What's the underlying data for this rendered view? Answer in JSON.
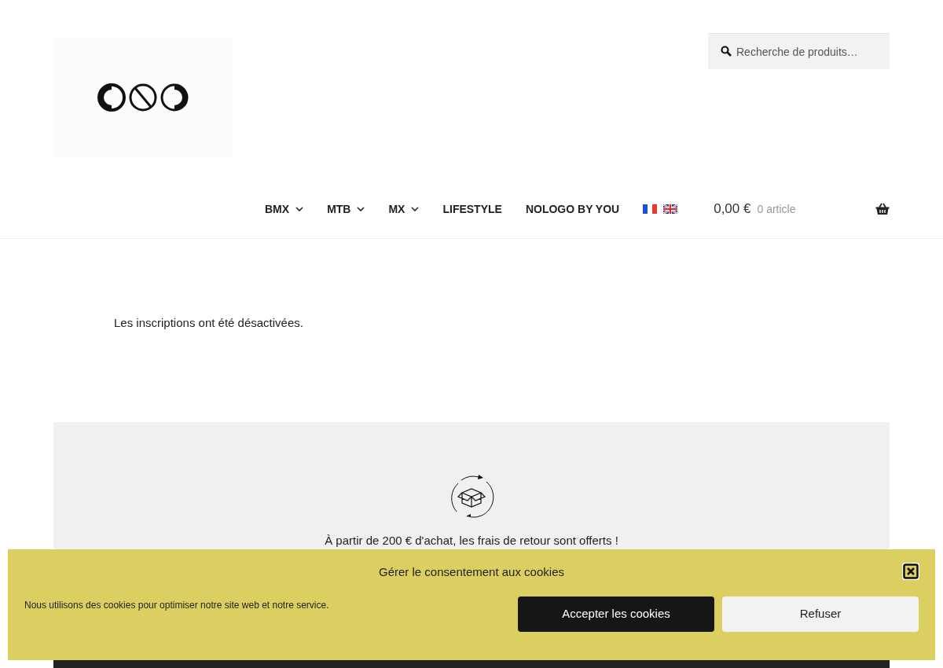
{
  "header": {
    "search": {
      "placeholder": "Recherche de produits…"
    },
    "nav": [
      {
        "label": "BMX",
        "has_dropdown": true
      },
      {
        "label": "MTB",
        "has_dropdown": true
      },
      {
        "label": "MX",
        "has_dropdown": true
      },
      {
        "label": "LIFESTYLE",
        "has_dropdown": false
      },
      {
        "label": "NOLOGO BY YOU",
        "has_dropdown": false
      }
    ],
    "cart": {
      "total": "0,00 €",
      "count": "0 article"
    }
  },
  "notice": "Les inscriptions ont été désactivées.",
  "returns_banner": {
    "text": "À partir de 200 € d'achat, les frais de retour sont offerts !"
  },
  "cookie_banner": {
    "title": "Gérer le consentement aux cookies",
    "message": "Nous utilisons des cookies pour optimiser notre site web et notre service.",
    "buttons": [
      {
        "label": "Accepter les cookies",
        "kind": "primary"
      },
      {
        "label": "Refuser",
        "kind": "secondary"
      }
    ]
  }
}
